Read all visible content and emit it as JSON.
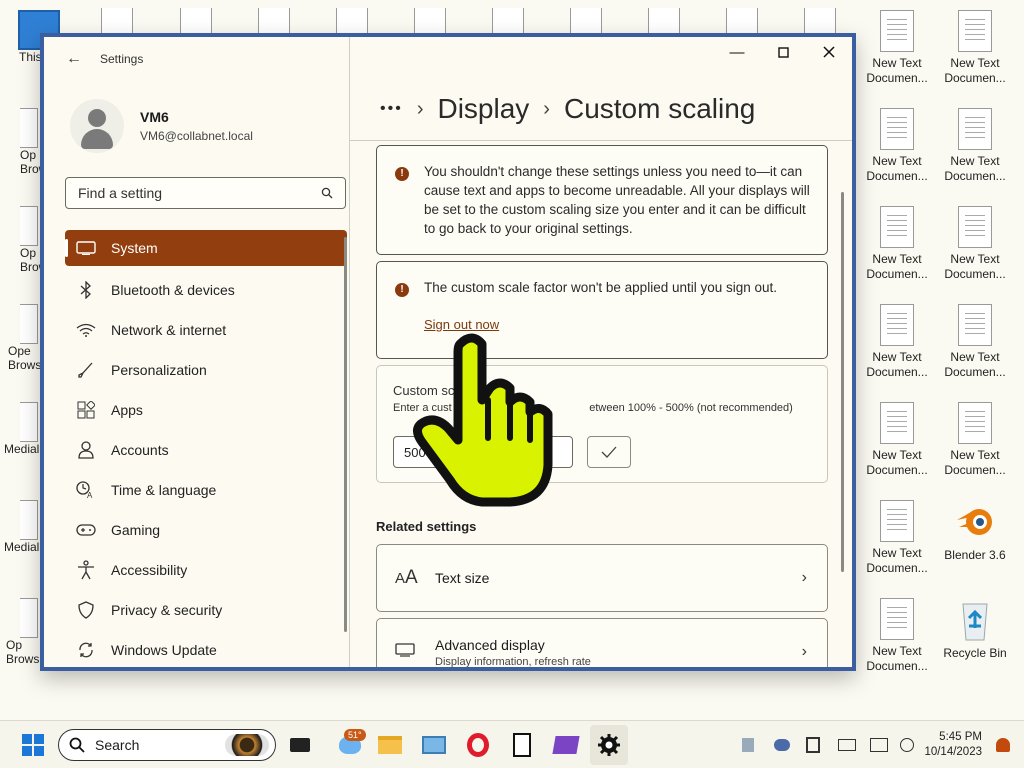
{
  "desktop": {
    "right_icons": [
      {
        "label": "New Text Documen..."
      },
      {
        "label": "New Text Documen..."
      },
      {
        "label": "New Text Documen..."
      },
      {
        "label": "New Text Documen..."
      },
      {
        "label": "New Text Documen..."
      },
      {
        "label": "New Text Documen..."
      },
      {
        "label": "New Text Documen..."
      },
      {
        "label": "New Text Documen..."
      },
      {
        "label": "New Text Documen..."
      },
      {
        "label": "New Text Documen..."
      },
      {
        "label": "New Text Documen..."
      },
      {
        "label": "Blender 3.6"
      },
      {
        "label": "New Text Documen..."
      },
      {
        "label": "Recycle Bin"
      }
    ],
    "left_stubs": [
      "This",
      "Op Brow",
      "Op Brow",
      "Ope Brows",
      "Medial",
      "Medial",
      "Op Brows"
    ]
  },
  "settings": {
    "app_title": "Settings",
    "profile": {
      "name": "VM6",
      "email": "VM6@collabnet.local"
    },
    "search_placeholder": "Find a setting",
    "nav": [
      {
        "label": "System",
        "icon": "monitor-icon",
        "active": true
      },
      {
        "label": "Bluetooth & devices",
        "icon": "bluetooth-icon"
      },
      {
        "label": "Network & internet",
        "icon": "wifi-icon"
      },
      {
        "label": "Personalization",
        "icon": "brush-icon"
      },
      {
        "label": "Apps",
        "icon": "apps-icon"
      },
      {
        "label": "Accounts",
        "icon": "person-icon"
      },
      {
        "label": "Time & language",
        "icon": "time-language-icon"
      },
      {
        "label": "Gaming",
        "icon": "gamepad-icon"
      },
      {
        "label": "Accessibility",
        "icon": "accessibility-icon"
      },
      {
        "label": "Privacy & security",
        "icon": "shield-icon"
      },
      {
        "label": "Windows Update",
        "icon": "update-icon"
      }
    ],
    "breadcrumb": {
      "ellipsis": "•••",
      "page1": "Display",
      "page2": "Custom scaling"
    },
    "warning1": "You shouldn't change these settings unless you need to—it can cause text and apps to become unreadable. All your displays will be set to the custom scaling size you enter and it can be difficult to go back to your original settings.",
    "warning2": "The custom scale factor won't be applied until you sign out.",
    "sign_out_link": "Sign out now",
    "custom_scale": {
      "label": "Custom sc",
      "hint": "Enter a cust                                             etween 100% - 500% (not recommended)",
      "value": "500"
    },
    "related_title": "Related settings",
    "related": [
      {
        "label": "Text size",
        "sub": ""
      },
      {
        "label": "Advanced display",
        "sub": "Display information, refresh rate"
      }
    ]
  },
  "taskbar": {
    "search_label": "Search",
    "weather_badge": "51°",
    "time": "5:45 PM",
    "date": "10/14/2023"
  },
  "colors": {
    "accent": "#923e0e",
    "window_border": "#3b5ea0",
    "warning_icon": "#8a3a0d",
    "cursor": "#d4f000"
  }
}
